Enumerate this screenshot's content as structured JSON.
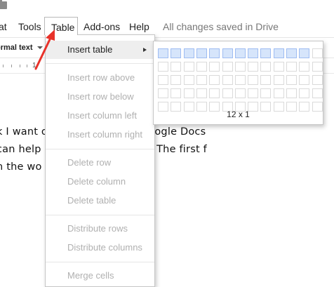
{
  "menubar": {
    "items": [
      {
        "label": "at"
      },
      {
        "label": "Tools"
      },
      {
        "label": "Table"
      },
      {
        "label": "Add-ons"
      },
      {
        "label": "Help"
      }
    ],
    "save_status": "All changes saved in Drive"
  },
  "toolbar": {
    "paragraph_style": "ormal text"
  },
  "ruler": {
    "number": "1"
  },
  "document": {
    "lines": [
      ".",
      "k I want ols you can find in Google Docs",
      "can help ns for your students. The first f",
      "n the wo"
    ]
  },
  "table_menu": {
    "items": [
      {
        "label": "Insert table",
        "enabled": true,
        "has_submenu": true
      },
      {
        "label": "Insert row above",
        "enabled": false
      },
      {
        "label": "Insert row below",
        "enabled": false
      },
      {
        "label": "Insert column left",
        "enabled": false
      },
      {
        "label": "Insert column right",
        "enabled": false
      },
      {
        "label": "Delete row",
        "enabled": false
      },
      {
        "label": "Delete column",
        "enabled": false
      },
      {
        "label": "Delete table",
        "enabled": false
      },
      {
        "label": "Distribute rows",
        "enabled": false
      },
      {
        "label": "Distribute columns",
        "enabled": false
      },
      {
        "label": "Merge cells",
        "enabled": false
      }
    ]
  },
  "table_picker": {
    "size_label": "12 x 1",
    "selected_columns": 12,
    "selected_rows": 1,
    "highlight_color": "#d6e5fb"
  },
  "annotation": {
    "color": "#e8322a",
    "icon": "red-arrow-icon"
  }
}
